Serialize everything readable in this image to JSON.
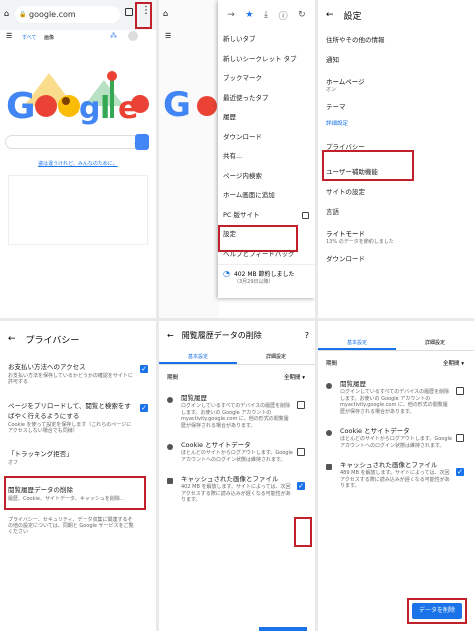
{
  "p1": {
    "url": "google.com",
    "nav_all": "すべて",
    "nav_images": "画像",
    "search_link": "姿は違うけれど、みんなのために。"
  },
  "p2": {
    "menu_items": [
      "新しいタブ",
      "新しいシークレット タブ",
      "ブックマーク",
      "最近使ったタブ",
      "履歴",
      "ダウンロード",
      "共有...",
      "ページ内検索",
      "ホーム画面に追加",
      "PC 版サイト",
      "設定",
      "ヘルプとフィードバック"
    ],
    "saved_text": "402 MB 節約しました",
    "saved_sub": "（3月29日以降）"
  },
  "p3": {
    "title": "設定",
    "rows": [
      "住所やその他の情報",
      "通知"
    ],
    "homepage": "ホームページ",
    "homepage_state": "オン",
    "theme": "テーマ",
    "section_advanced": "詳細設定",
    "rows2": [
      "プライバシー",
      "ユーザー補助機能",
      "サイトの設定",
      "言語"
    ],
    "lite": "ライトモード",
    "lite_sub": "13% のデータを節約しました",
    "download": "ダウンロード"
  },
  "p4": {
    "title": "プライバシー",
    "items": [
      {
        "t": "お支払い方法へのアクセス",
        "d": "お支払い方法を保存しているかどうかの確認をサイトに許可する"
      },
      {
        "t": "ページをプリロードして、閲覧と検索をすばやく行えるようにする",
        "d": "Cookie を使って設定を保存します（これらのページにアクセスしない場合でも同様）"
      },
      {
        "t": "「トラッキング拒否」",
        "d": "オフ"
      },
      {
        "t": "閲覧履歴データの削除",
        "d": "履歴、Cookie、サイトデータ、キャッシュを削除..."
      }
    ],
    "footer": "プライバシー、セキュリティ、データ収集に関連するその他の設定については、同期と Google サービスをご覧ください"
  },
  "p5": {
    "title": "閲覧履歴データの削除",
    "tab_basic": "基本設定",
    "tab_advanced": "詳細設定",
    "period_label": "期間",
    "period_value": "全期間",
    "entries": [
      {
        "t": "閲覧履歴",
        "d": "ログインしているすべてのデバイスの履歴を削除します。お使いの Google アカウントの myactivity.google.com に、他の形式の閲覧履歴が保存される場合があります。"
      },
      {
        "t": "Cookie とサイトデータ",
        "d": "ほとんどのサイトからログアウトします。Google アカウントへのログイン状態は維持されます。"
      },
      {
        "t": "キャッシュされた画像とファイル",
        "d": "402 MB を解放します。サイトによっては、次回アクセスする際に読み込みが遅くなる可能性があります。"
      }
    ]
  },
  "p6": {
    "tab_basic": "基本設定",
    "tab_advanced": "詳細設定",
    "period_label": "期間",
    "period_value": "全期間",
    "entries": [
      {
        "t": "閲覧履歴",
        "d": "ログインしているすべてのデバイスの履歴を削除します。お使いの Google アカウントの myactivity.google.com に、他の形式の閲覧履歴が保存される場合があります。"
      },
      {
        "t": "Cookie とサイトデータ",
        "d": "ほとんどのサイトからログアウトします。Google アカウントへのログイン状態は維持されます。"
      },
      {
        "t": "キャッシュされた画像とファイル",
        "d": "489 MB を解放します。サイトによっては、次回アクセスする際に読み込みが遅くなる可能性があります。"
      }
    ],
    "clear_button": "データを削除"
  },
  "colors": {
    "accent": "#1a73e8",
    "highlight": "#c0202a"
  }
}
